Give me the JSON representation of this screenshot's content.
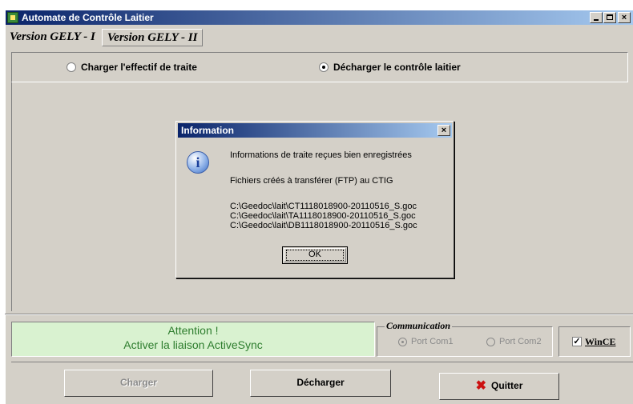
{
  "window": {
    "title": "Automate de Contrôle Laitier"
  },
  "tabs": [
    {
      "label": "Version GELY - I"
    },
    {
      "label": "Version GELY - II"
    }
  ],
  "mode": {
    "option1": "Charger l'effectif de traite",
    "option2": "Décharger le contrôle laitier",
    "selected": "option2"
  },
  "dialog": {
    "title": "Information",
    "line1": "Informations de traite reçues bien enregistrées",
    "line2": "Fichiers créés à transférer (FTP) au CTIG",
    "files": [
      "C:\\Geedoc\\lait\\CT1118018900-20110516_S.goc",
      "C:\\Geedoc\\lait\\TA1118018900-20110516_S.goc",
      "C:\\Geedoc\\lait\\DB1118018900-20110516_S.goc"
    ],
    "ok": "OK",
    "close": "×"
  },
  "status": {
    "line1": "Attention !",
    "line2": "Activer la liaison ActiveSync"
  },
  "communication": {
    "label": "Communication",
    "port1": "Port Com1",
    "port2": "Port Com2",
    "wince": "WinCE",
    "wince_checked": true
  },
  "buttons": {
    "charger": "Charger",
    "decharger": "Décharger",
    "quitter": "Quitter"
  },
  "colors": {
    "titlebar": "#0a246a",
    "alert_bg": "#d9f2d0",
    "alert_text": "#2e7d2e",
    "quit_icon": "#cc1111"
  }
}
